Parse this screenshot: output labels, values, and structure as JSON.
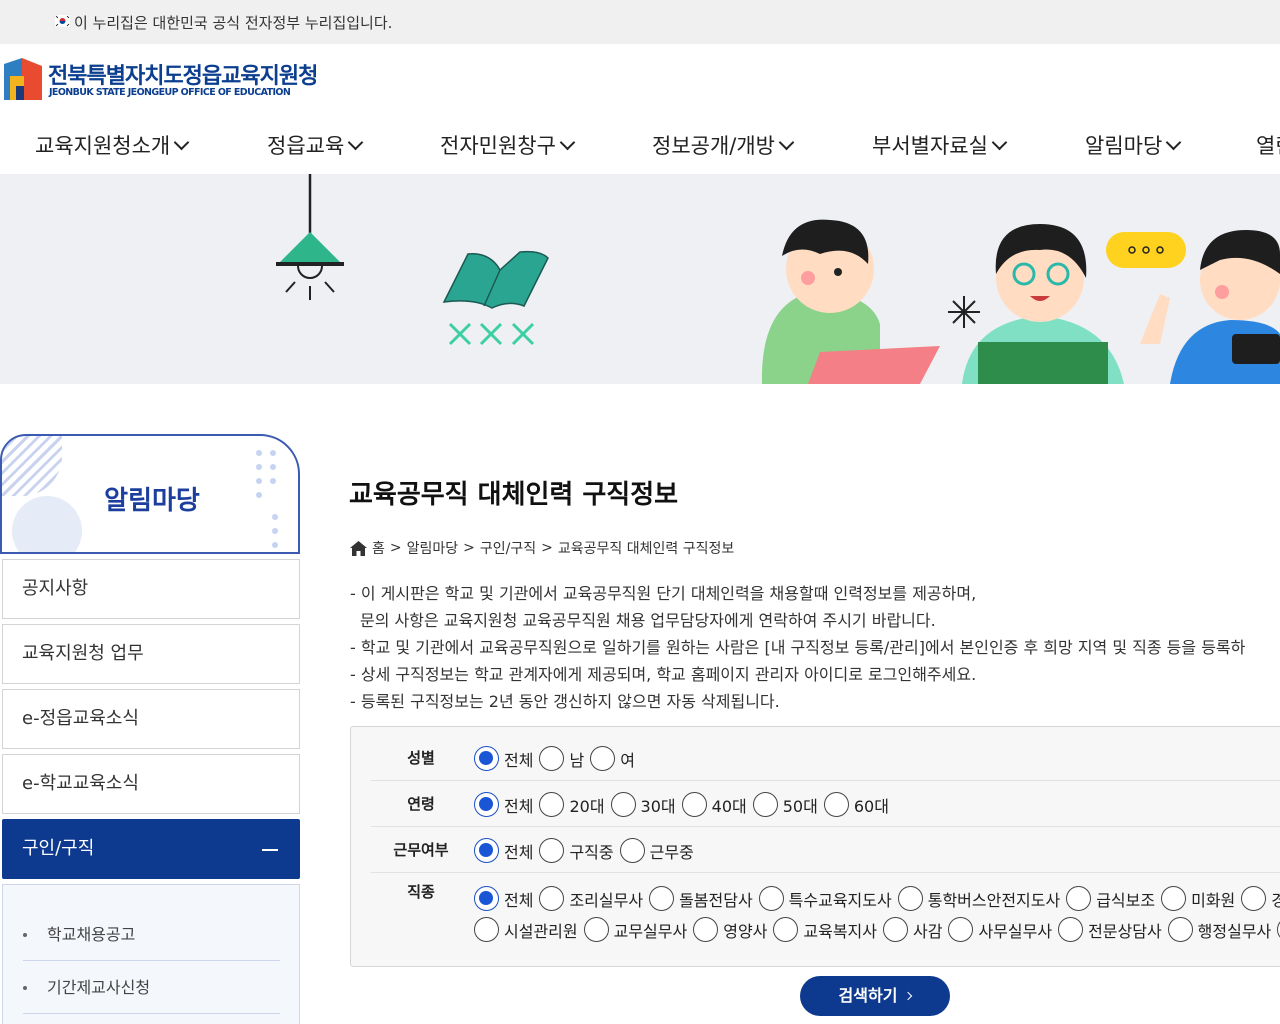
{
  "gov_banner": {
    "text": "이 누리집은 대한민국 공식 전자정부 누리집입니다."
  },
  "logo": {
    "name_ko": "전북특별자치도정읍교육지원청",
    "name_en": "JEONBUK STATE JEONGEUP OFFICE OF EDUCATION"
  },
  "gnb": [
    {
      "label": "교육지원청소개"
    },
    {
      "label": "정읍교육"
    },
    {
      "label": "전자민원창구"
    },
    {
      "label": "정보공개/개방"
    },
    {
      "label": "부서별자료실"
    },
    {
      "label": "알림마당"
    },
    {
      "label": "열린"
    }
  ],
  "sidebar": {
    "title": "알림마당",
    "items": [
      {
        "label": "공지사항"
      },
      {
        "label": "교육지원청 업무"
      },
      {
        "label": "e-정읍교육소식"
      },
      {
        "label": "e-학교교육소식"
      },
      {
        "label": "구인/구직",
        "active": true
      }
    ],
    "sub_items": [
      {
        "label": "학교채용공고"
      },
      {
        "label": "기간제교사신청"
      }
    ]
  },
  "content": {
    "title": "교육공무직 대체인력 구직정보",
    "breadcrumb": [
      "홈",
      "알림마당",
      "구인/구직",
      "교육공무직 대체인력 구직정보"
    ],
    "breadcrumb_sep": ">",
    "notice": [
      "- 이 게시판은 학교 및 기관에서 교육공무직원 단기 대체인력을 채용할때 인력정보를 제공하며,",
      "  문의 사항은 교육지원청 교육공무직원 채용 업무담당자에게 연락하여 주시기 바랍니다.",
      "- 학교 및 기관에서 교육공무직원으로 일하기를 원하는 사람은 [내 구직정보 등록/관리]에서 본인인증 후 희망 지역 및 직종 등을 등록하",
      "- 상세 구직정보는 학교 관계자에게 제공되며, 학교 홈페이지 관리자 아이디로 로그인해주세요.",
      "- 등록된 구직정보는 2년 동안 갱신하지 않으면 자동 삭제됩니다."
    ]
  },
  "search": {
    "gender": {
      "label": "성별",
      "options": [
        "전체",
        "남",
        "여"
      ],
      "selected": "전체"
    },
    "age": {
      "label": "연령",
      "options": [
        "전체",
        "20대",
        "30대",
        "40대",
        "50대",
        "60대"
      ],
      "selected": "전체"
    },
    "work": {
      "label": "근무여부",
      "options": [
        "전체",
        "구직중",
        "근무중"
      ],
      "selected": "전체"
    },
    "job": {
      "label": "직종",
      "options_line1": [
        "전체",
        "조리실무사",
        "돌봄전담사",
        "특수교육지도사",
        "통학버스안전지도사",
        "급식보조",
        "미화원",
        "경비원"
      ],
      "options_line2": [
        "시설관리원",
        "교무실무사",
        "영양사",
        "교육복지사",
        "사감",
        "사무실무사",
        "전문상담사",
        "행정실무사",
        ""
      ],
      "selected": "전체"
    },
    "button_label": "검색하기"
  },
  "colors": {
    "primary": "#0d3a8e",
    "radio_on": "#1a55d6",
    "hero_bg": "#eef0f4"
  }
}
